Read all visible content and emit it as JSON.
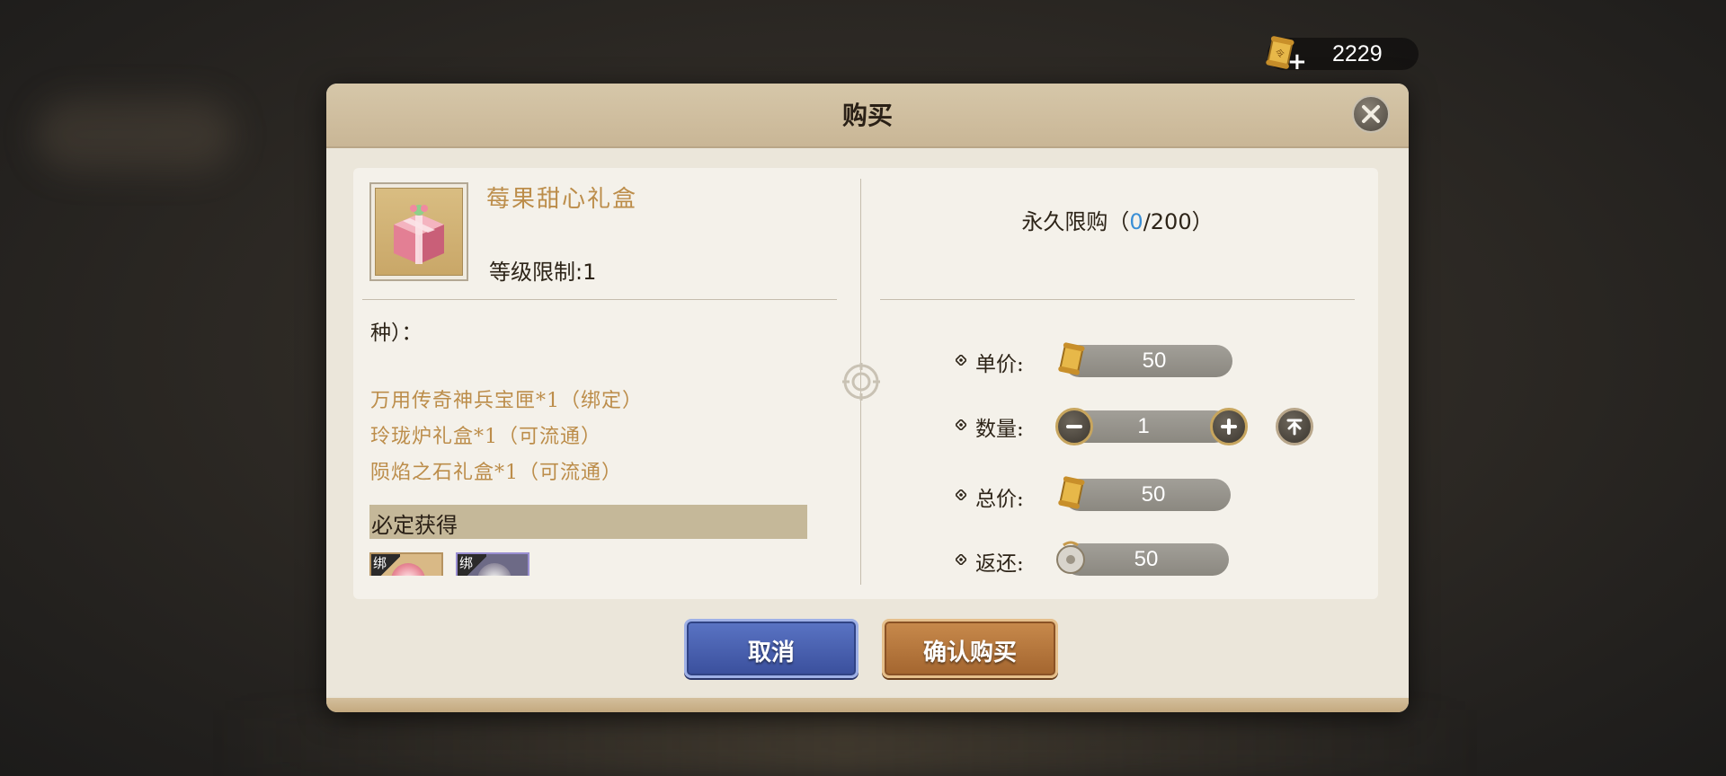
{
  "currency": {
    "icon": "scroll-coin-icon",
    "plus": "+",
    "amount": "2229"
  },
  "dialog": {
    "title": "购买",
    "close_icon": "close-icon"
  },
  "item": {
    "name": "莓果甜心礼盒",
    "level_limit": "等级限制:1",
    "description_label": "种）：",
    "contents": [
      "万用传奇神兵宝匣*1（绑定）",
      "玲珑炉礼盒*1（可流通）",
      "陨焰之石礼盒*1（可流通）"
    ],
    "guaranteed_label": "必定获得",
    "rewards": [
      {
        "tag": "绑"
      },
      {
        "tag": "绑"
      }
    ]
  },
  "purchase": {
    "limit_prefix": "永久限购",
    "limit_open": "（",
    "limit_current": "0",
    "limit_sep": "/",
    "limit_max": "200",
    "limit_close": "）",
    "unit_price_label": "单价:",
    "unit_price": "50",
    "quantity_label": "数量:",
    "quantity": "1",
    "total_label": "总价:",
    "total": "50",
    "refund_label": "返还:",
    "refund": "50"
  },
  "buttons": {
    "cancel": "取消",
    "confirm": "确认购买"
  },
  "colors": {
    "gold_text": "#bc8d4a",
    "limit_current": "#3a8fd6",
    "cancel_button": "#3a4f9c",
    "confirm_button": "#a3652f"
  }
}
